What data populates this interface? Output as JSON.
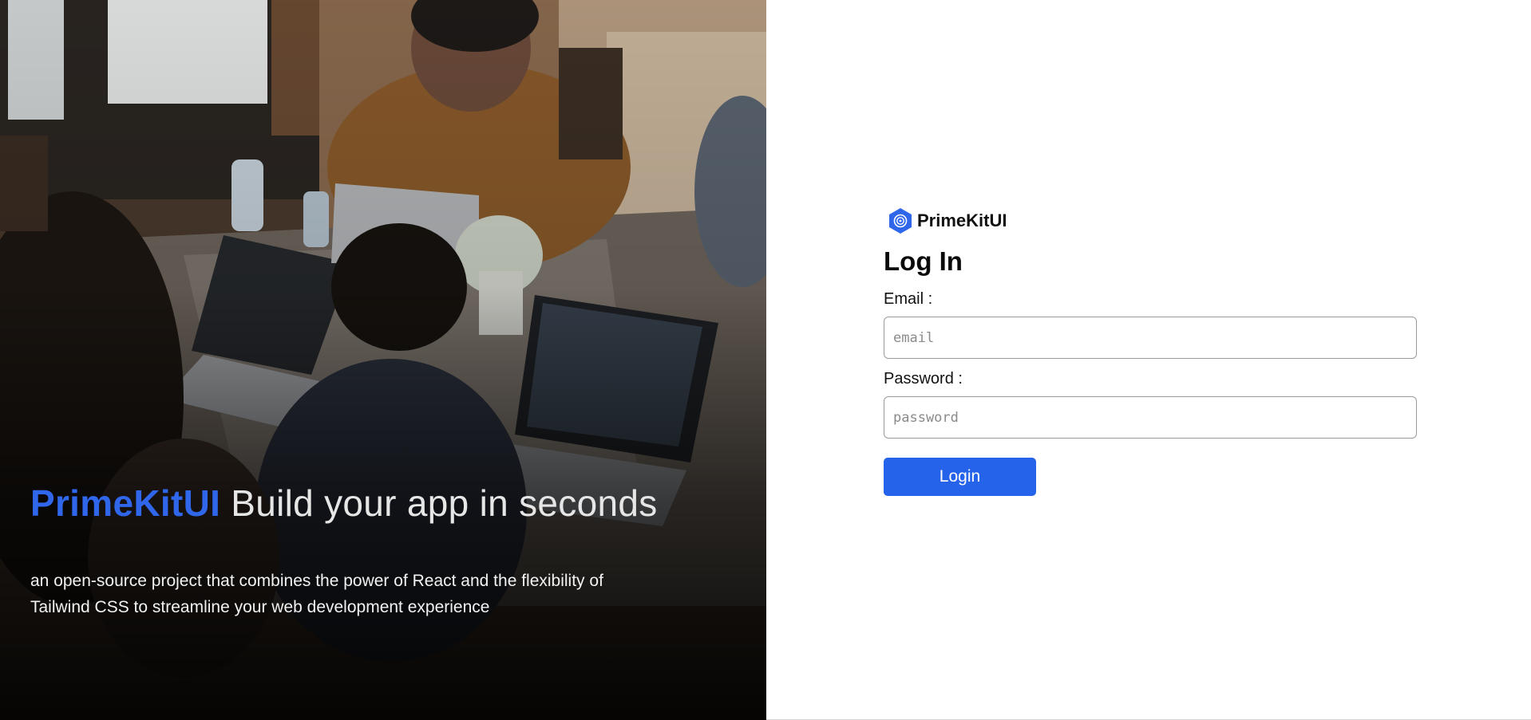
{
  "hero": {
    "brand": "PrimeKitUI",
    "headline_rest": " Build your app in seconds",
    "description": "an open-source project that combines the power of React and the flexibility of Tailwind CSS to streamline your web development experience",
    "photo_icon": "team-working-on-laptops-photo"
  },
  "login": {
    "logo_icon": "hexagon-logo-icon",
    "brand_name": "PrimeKitUI",
    "title": "Log In",
    "email_label": "Email :",
    "email_placeholder": "email",
    "email_value": "",
    "password_label": "Password :",
    "password_placeholder": "password",
    "password_value": "",
    "button_label": "Login"
  },
  "colors": {
    "brand_accent": "#2f66ea",
    "button_bg": "#2563eb",
    "button_text": "#ffffff"
  }
}
